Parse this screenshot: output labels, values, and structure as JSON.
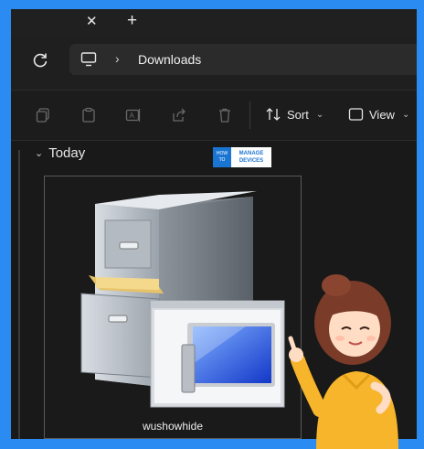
{
  "tabbar": {
    "close_glyph": "✕",
    "add_glyph": "+"
  },
  "address": {
    "refresh_icon": "refresh-icon",
    "device_icon": "monitor-icon",
    "separator": "›",
    "location": "Downloads"
  },
  "toolbar": {
    "icons": [
      "copy-icon",
      "paste-icon",
      "rename-icon",
      "share-icon",
      "delete-icon"
    ],
    "sort_label": "Sort",
    "view_label": "View"
  },
  "content": {
    "group_label": "Today",
    "file": {
      "name": "wushowhide",
      "icon": "file-cabinet-computer-icon"
    }
  },
  "watermark": {
    "left_top": "HOW",
    "left_bottom": "TO",
    "right_top": "MANAGE",
    "right_bottom": "DEVICES"
  },
  "colors": {
    "frame": "#2a8cf2",
    "window": "#191919",
    "toolbar": "#1c1c1c",
    "text": "#ececec"
  }
}
